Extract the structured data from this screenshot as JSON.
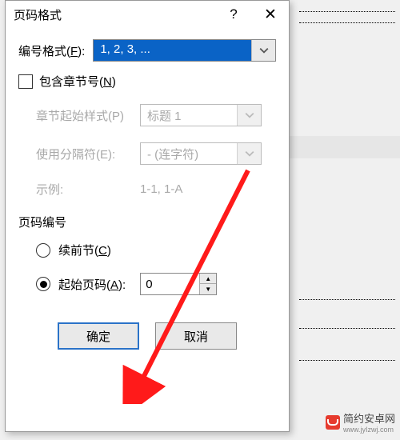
{
  "dialog": {
    "title": "页码格式",
    "help_icon": "?",
    "close_icon": "✕"
  },
  "number_format": {
    "label_prefix": "编号格式(",
    "label_key": "F",
    "label_suffix": "):",
    "value": "1, 2, 3, ..."
  },
  "include_chapter": {
    "label_prefix": "包含章节号(",
    "label_key": "N",
    "label_suffix": ")",
    "checked": false
  },
  "chapter_start_style": {
    "label": "章节起始样式(P)",
    "value": "标题 1"
  },
  "separator": {
    "label": "使用分隔符(E):",
    "value": "- (连字符)"
  },
  "example": {
    "label": "示例:",
    "value": "1-1, 1-A"
  },
  "page_number_section": {
    "label": "页码编号"
  },
  "continue_prev": {
    "label_prefix": "续前节(",
    "label_key": "C",
    "label_suffix": ")",
    "selected": false
  },
  "start_at": {
    "label_prefix": "起始页码(",
    "label_key": "A",
    "label_suffix": "):",
    "selected": true,
    "value": "0"
  },
  "buttons": {
    "ok": "确定",
    "cancel": "取消"
  },
  "watermark": {
    "text": "简约安卓网",
    "url": "www.jyIzwj.com"
  }
}
